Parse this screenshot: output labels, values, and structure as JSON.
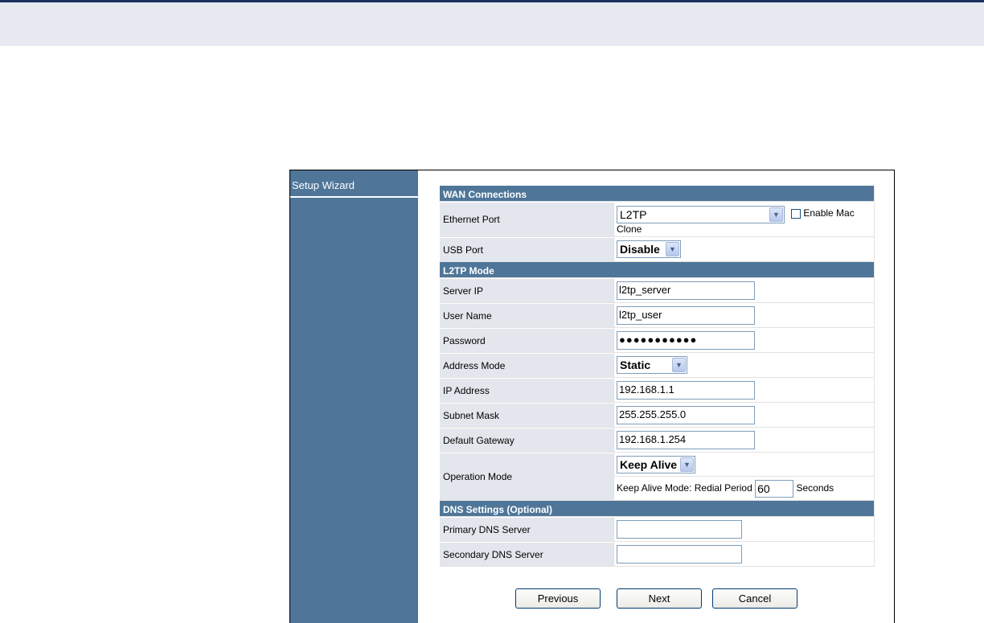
{
  "sidebar": {
    "items": [
      {
        "label": "Setup Wizard"
      }
    ]
  },
  "sections": {
    "wan": "WAN Connections",
    "l2tp": "L2TP Mode",
    "dns": "DNS Settings (Optional)"
  },
  "wan": {
    "ethernet_label": "Ethernet Port",
    "ethernet_value": "L2TP",
    "enable_mac_label": "Enable Mac",
    "clone_label": "Clone",
    "enable_mac_checked": false,
    "usb_label": "USB Port",
    "usb_value": "Disable"
  },
  "l2tp": {
    "server_ip_label": "Server IP",
    "server_ip_value": "l2tp_server",
    "username_label": "User Name",
    "username_value": "l2tp_user",
    "password_label": "Password",
    "password_value": "●●●●●●●●●●●",
    "address_mode_label": "Address Mode",
    "address_mode_value": "Static",
    "ip_label": "IP Address",
    "ip_value": "192.168.1.1",
    "subnet_label": "Subnet Mask",
    "subnet_value": "255.255.255.0",
    "gateway_label": "Default Gateway",
    "gateway_value": "192.168.1.254",
    "opmode_label": "Operation Mode",
    "opmode_value": "Keep Alive",
    "redial_prefix": "Keep Alive Mode: Redial Period",
    "redial_value": "60",
    "redial_suffix": "Seconds"
  },
  "dns": {
    "primary_label": "Primary DNS Server",
    "primary_value": "",
    "secondary_label": "Secondary DNS Server",
    "secondary_value": ""
  },
  "buttons": {
    "previous": "Previous",
    "next": "Next",
    "cancel": "Cancel"
  },
  "colors": {
    "accent": "#4f7699",
    "label_bg": "#e4e6ed",
    "topbar_border": "#1c2f5e",
    "topbar_bg": "#e6e9f0"
  },
  "icons": {
    "dropdown": "chevron-down-icon",
    "checkbox": "checkbox-icon"
  }
}
